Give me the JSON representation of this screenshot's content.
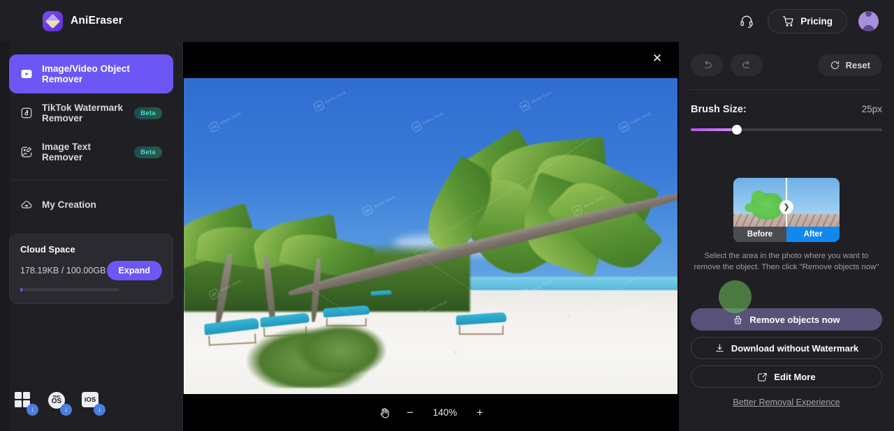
{
  "app": {
    "brand_name": "AniEraser",
    "brand_icon": "eraser-logo-icon"
  },
  "topbar": {
    "support_icon": "headset-icon",
    "pricing_label": "Pricing",
    "cart_icon": "cart-icon",
    "avatar_icon": "user-avatar-icon"
  },
  "sidebar": {
    "items": [
      {
        "label": "Image/Video Object Remover",
        "icon": "video-play-icon",
        "badge": "",
        "active": true
      },
      {
        "label": "TikTok Watermark Remover",
        "icon": "music-note-icon",
        "badge": "Beta",
        "active": false
      },
      {
        "label": "Image Text Remover",
        "icon": "image-text-icon",
        "badge": "Beta",
        "active": false
      }
    ],
    "my_creation": {
      "label": "My Creation",
      "icon": "cloud-creation-icon"
    },
    "cloud": {
      "title": "Cloud Space",
      "usage": "178.19KB / 100.00GB",
      "expand_label": "Expand",
      "used_percent": 2
    },
    "downloads": [
      {
        "name": "windows-download-icon",
        "label": ""
      },
      {
        "name": "macos-download-icon",
        "label_small": "mac",
        "label_big": "OS"
      },
      {
        "name": "ios-download-icon",
        "label": "iOS"
      }
    ]
  },
  "canvas": {
    "close_icon": "close-icon",
    "brush_cursor_icon": "brush-cursor-circle",
    "zoom": {
      "hand_icon": "hand-pan-icon",
      "minus": "−",
      "value": "140%",
      "plus": "+"
    },
    "watermark": {
      "mark": "m",
      "text": "Adobe Stock"
    }
  },
  "right_panel": {
    "undo_icon": "undo-icon",
    "redo_icon": "redo-icon",
    "reset_label": "Reset",
    "reset_icon": "reset-icon",
    "brush": {
      "label": "Brush Size:",
      "value": "25px",
      "percent": 24
    },
    "preview": {
      "before_label": "Before",
      "after_label": "After",
      "chevron_icon": "chevron-right-icon",
      "caption": "Select the area in the photo where you want to remove the object. Then click \"Remove objects now\""
    },
    "actions": {
      "remove_label": "Remove objects now",
      "remove_icon": "eraser-brush-icon",
      "download_label": "Download without Watermark",
      "download_icon": "download-icon",
      "edit_label": "Edit More",
      "edit_icon": "edit-square-icon",
      "better_link": "Better Removal Experience"
    }
  },
  "colors": {
    "accent_purple": "#6c56f5",
    "panel_bg": "#202024",
    "canvas_bg": "#000000",
    "beta_text": "#49e0c4",
    "slider_fill": "#c06ff2",
    "after_badge": "#1188ee"
  }
}
